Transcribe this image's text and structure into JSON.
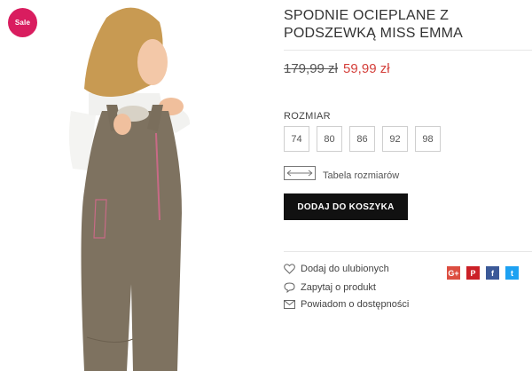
{
  "product": {
    "title": "SPODNIE OCIEPLANE Z PODSZEWKĄ MISS EMMA",
    "sale_badge": "Sale",
    "price_old": "179,99 zł",
    "price_new": "59,99 zł"
  },
  "sizes": {
    "label": "ROZMIAR",
    "options": [
      "74",
      "80",
      "86",
      "92",
      "98"
    ]
  },
  "size_table_label": "Tabela rozmiarów",
  "add_to_cart_label": "DODAJ DO KOSZYKA",
  "actions": {
    "wishlist": "Dodaj do ulubionych",
    "ask": "Zapytaj o produkt",
    "notify": "Powiadom o dostępności"
  },
  "social": {
    "icons": [
      "google-plus-icon",
      "pinterest-icon",
      "facebook-icon",
      "twitter-icon"
    ],
    "glyphs": [
      "G+",
      "P",
      "f",
      "t"
    ],
    "colors": [
      "#dc4e41",
      "#cb2027",
      "#3b5998",
      "#1da1f2"
    ]
  },
  "colors": {
    "sale_badge": "#d91d5f",
    "price_new": "#d43f3a",
    "button": "#111111"
  }
}
